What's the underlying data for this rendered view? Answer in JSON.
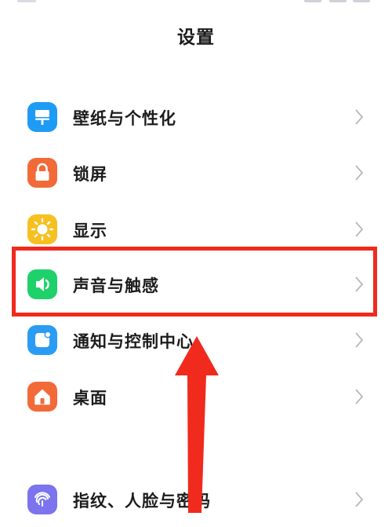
{
  "header": {
    "title": "设置"
  },
  "settings": [
    {
      "label": "壁纸与个性化",
      "icon": "wallpaper-icon",
      "color": "#1e9bf5"
    },
    {
      "label": "锁屏",
      "icon": "lock-icon",
      "color": "#f26a38"
    },
    {
      "label": "显示",
      "icon": "sun-icon",
      "color": "#f7c021"
    },
    {
      "label": "声音与触感",
      "icon": "speaker-icon",
      "color": "#1fd16a"
    },
    {
      "label": "通知与控制中心",
      "icon": "notification-icon",
      "color": "#2a9cf3"
    },
    {
      "label": "桌面",
      "icon": "home-icon",
      "color": "#f26a38"
    },
    {
      "label": "指纹、人脸与密码",
      "icon": "fingerprint-icon",
      "color": "#7b74ee"
    }
  ],
  "annotation": {
    "highlight_color": "#f02a1c",
    "highlighted_item": "声音与触感"
  }
}
